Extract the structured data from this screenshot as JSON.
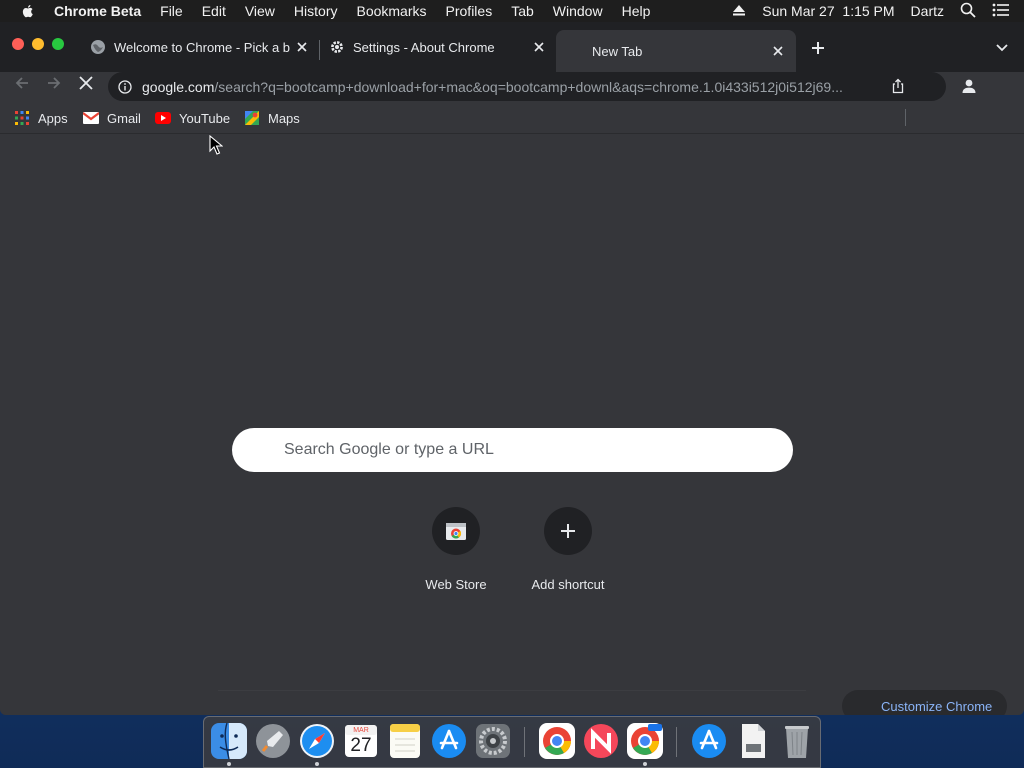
{
  "menubar": {
    "app_name": "Chrome Beta",
    "items": [
      "File",
      "Edit",
      "View",
      "History",
      "Bookmarks",
      "Profiles",
      "Tab",
      "Window",
      "Help"
    ],
    "clock": "Sun Mar 27  1:15 PM",
    "user": "Dartz",
    "icons": [
      "apple-icon",
      "eject-icon",
      "spotlight-icon",
      "control-center-icon"
    ]
  },
  "tabs": [
    {
      "title": "Welcome to Chrome - Pick a b",
      "icon": "globe-icon",
      "active": false
    },
    {
      "title": "Settings - About Chrome",
      "icon": "gear-icon",
      "active": false
    },
    {
      "title": "New Tab",
      "icon": "",
      "active": true
    }
  ],
  "toolbar": {
    "url_host": "google.com",
    "url_rest": "/search?q=bootcamp+download+for+mac&oq=bootcamp+downl&aqs=chrome.1.0i433i512j0i512j69...",
    "loading": true
  },
  "bookmarks": [
    {
      "label": "Apps",
      "icon": "apps-grid-icon"
    },
    {
      "label": "Gmail",
      "icon": "gmail-icon"
    },
    {
      "label": "YouTube",
      "icon": "youtube-icon"
    },
    {
      "label": "Maps",
      "icon": "maps-icon"
    }
  ],
  "ntp": {
    "search_placeholder": "Search Google or type a URL",
    "shortcuts": [
      {
        "label": "Web Store",
        "icon": "web-store-icon"
      },
      {
        "label": "Add shortcut",
        "icon": "plus-icon"
      }
    ],
    "customize_label": "Customize Chrome"
  },
  "dock": {
    "calendar_month": "MAR",
    "calendar_day": "27",
    "apps": [
      "finder",
      "launchpad",
      "safari",
      "calendar",
      "notes",
      "app-store",
      "system-preferences",
      "chrome",
      "news",
      "chrome-beta",
      "applications-folder",
      "downloads",
      "trash"
    ],
    "colors": {
      "finder": "#3b8de6",
      "safari": "#1d8ef0",
      "appstore": "#1a8cf2",
      "news": "#f5475a",
      "chrome_red": "#ea4335",
      "chrome_yellow": "#fbbc05",
      "chrome_green": "#34a853",
      "chrome_blue": "#4285f4"
    }
  },
  "theme": {
    "frame": "#202124",
    "toolbar": "#35363a",
    "link_blue": "#8ab4f8"
  }
}
